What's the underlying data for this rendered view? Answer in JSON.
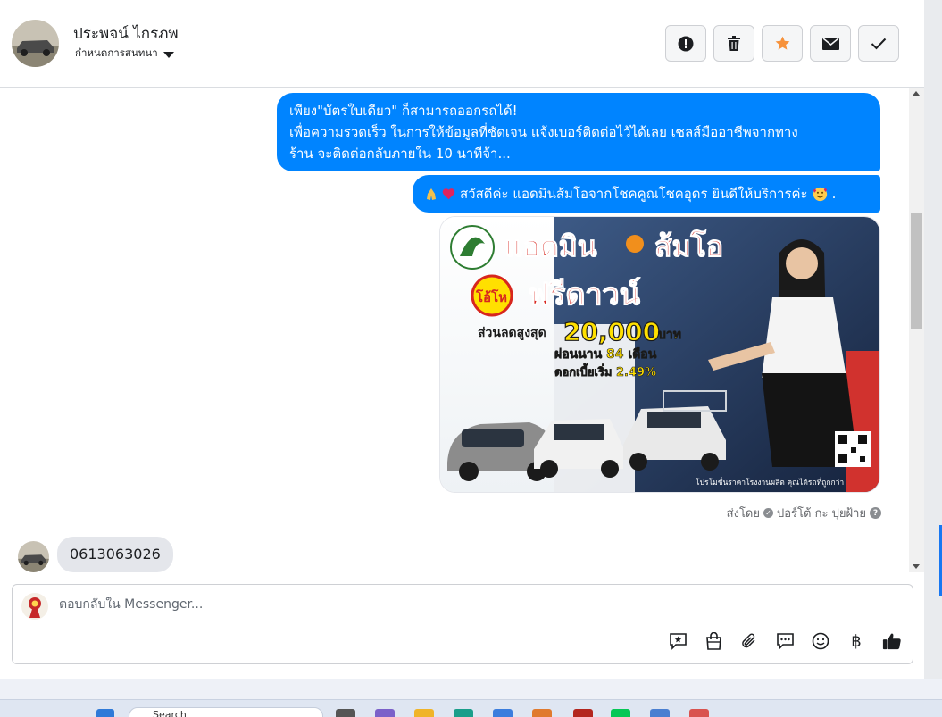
{
  "header": {
    "contact_name": "ประพจน์ ไกรภพ",
    "assign_label": "กำหนดการสนทนา",
    "actions": [
      {
        "name": "report-spam-icon"
      },
      {
        "name": "trash-icon"
      },
      {
        "name": "star-icon"
      },
      {
        "name": "mark-unread-icon"
      },
      {
        "name": "check-done-icon"
      }
    ]
  },
  "messages": {
    "out_1_line1": "เพียง\"บัตรใบเดียว\" ก็สามารถออกรถได้!",
    "out_1_line2": "เพื่อความรวดเร็ว ในการให้ข้อมูลที่ชัดเจน แจ้งเบอร์ติดต่อไว้ได้เลย เซลส์มืออาชีพจากทาง",
    "out_1_line3": "ร้าน จะติดต่อกลับภายใน 10 นาทีจ้า...",
    "out_2_text": "สวัสดีค่ะ แอดมินส้มโอจากโชคคูณโชคอุดร ยินดีให้บริการค่ะ",
    "out_2_end": ".",
    "promo_image": {
      "title_left": "แอดมิน",
      "title_right": "ส้มโอ",
      "badge": "โอ้โห",
      "headline": "ฟรีดาวน์",
      "discount_label": "ส่วนลดสูงสุด",
      "discount_value": "20,000",
      "discount_unit": "บาท",
      "installment": "ผ่อนนาน 84 เดือน",
      "interest": "ดอกเบี้ยเริ่ม 2.49%",
      "footer": "โปรโมชั่นราคาโรงงานผลิต คุณได้รถที่ถูกกว่า"
    },
    "sent_by_label": "ส่งโดย",
    "sent_by_name": "ปอร์โต้ กะ ปุยฝ้าย",
    "in_1_text": "0613063026"
  },
  "composer": {
    "placeholder": "ตอบกลับใน Messenger...",
    "tools": [
      "saved-reply-icon",
      "shop-bag-icon",
      "attach-icon",
      "quick-reply-icon",
      "emoji-icon",
      "baht-payment-icon",
      "like-icon"
    ],
    "baht_symbol": "฿"
  },
  "taskbar": {
    "search_label": "Search"
  },
  "colors": {
    "outgoing_bubble": "#0084ff",
    "incoming_bubble": "#e4e6eb",
    "star": "#f7923b",
    "poster_red": "#d7261e",
    "poster_yellow": "#ffe000"
  }
}
